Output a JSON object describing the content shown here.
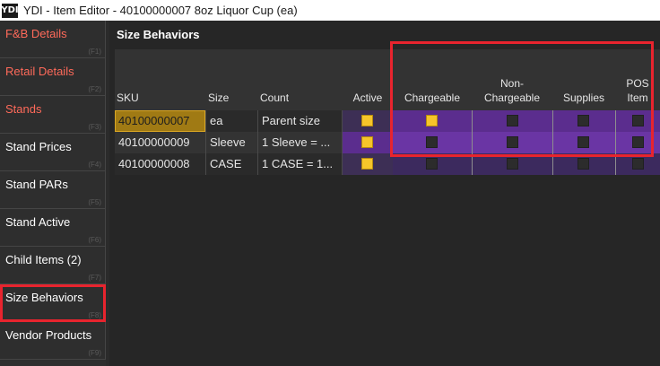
{
  "window": {
    "logo": "YDI",
    "title": "YDI - Item Editor - 40100000007 8oz Liquor Cup (ea)"
  },
  "sidebar": {
    "items": [
      {
        "label": "F&B Details",
        "key": "(F1)",
        "color": "red"
      },
      {
        "label": "Retail Details",
        "key": "(F2)",
        "color": "red"
      },
      {
        "label": "Stands",
        "key": "(F3)",
        "color": "red"
      },
      {
        "label": "Stand Prices",
        "key": "(F4)",
        "color": "white"
      },
      {
        "label": "Stand PARs",
        "key": "(F5)",
        "color": "white"
      },
      {
        "label": "Stand Active",
        "key": "(F6)",
        "color": "white"
      },
      {
        "label": "Child Items (2)",
        "key": "(F7)",
        "color": "white"
      },
      {
        "label": "Size Behaviors",
        "key": "(F8)",
        "color": "white",
        "selected": true
      },
      {
        "label": "Vendor Products",
        "key": "(F9)",
        "color": "white"
      }
    ]
  },
  "main": {
    "title": "Size Behaviors",
    "columns": {
      "sku": "SKU",
      "size": "Size",
      "count": "Count",
      "active": "Active",
      "chargeable": "Chargeable",
      "non_chargeable_1": "Non-",
      "non_chargeable_2": "Chargeable",
      "supplies": "Supplies",
      "pos_item_1": "POS",
      "pos_item_2": "Item"
    },
    "rows": [
      {
        "sku": "40100000007",
        "size": "ea",
        "count": "Parent size",
        "active": true,
        "chargeable": true,
        "non_chargeable": false,
        "supplies": false,
        "pos_item": false
      },
      {
        "sku": "40100000009",
        "size": "Sleeve",
        "count": "1 Sleeve = ...",
        "active": true,
        "chargeable": false,
        "non_chargeable": false,
        "supplies": false,
        "pos_item": false
      },
      {
        "sku": "40100000008",
        "size": "CASE",
        "count": "1 CASE = 1...",
        "active": true,
        "chargeable": false,
        "non_chargeable": false,
        "supplies": false,
        "pos_item": false
      }
    ]
  },
  "colors": {
    "checked": "#f6c52a",
    "highlight": "#e8242e",
    "purple_row": "#5b2d8e",
    "purple_dark": "#3c2a5e",
    "nav_red_text": "#ff6a5a"
  }
}
